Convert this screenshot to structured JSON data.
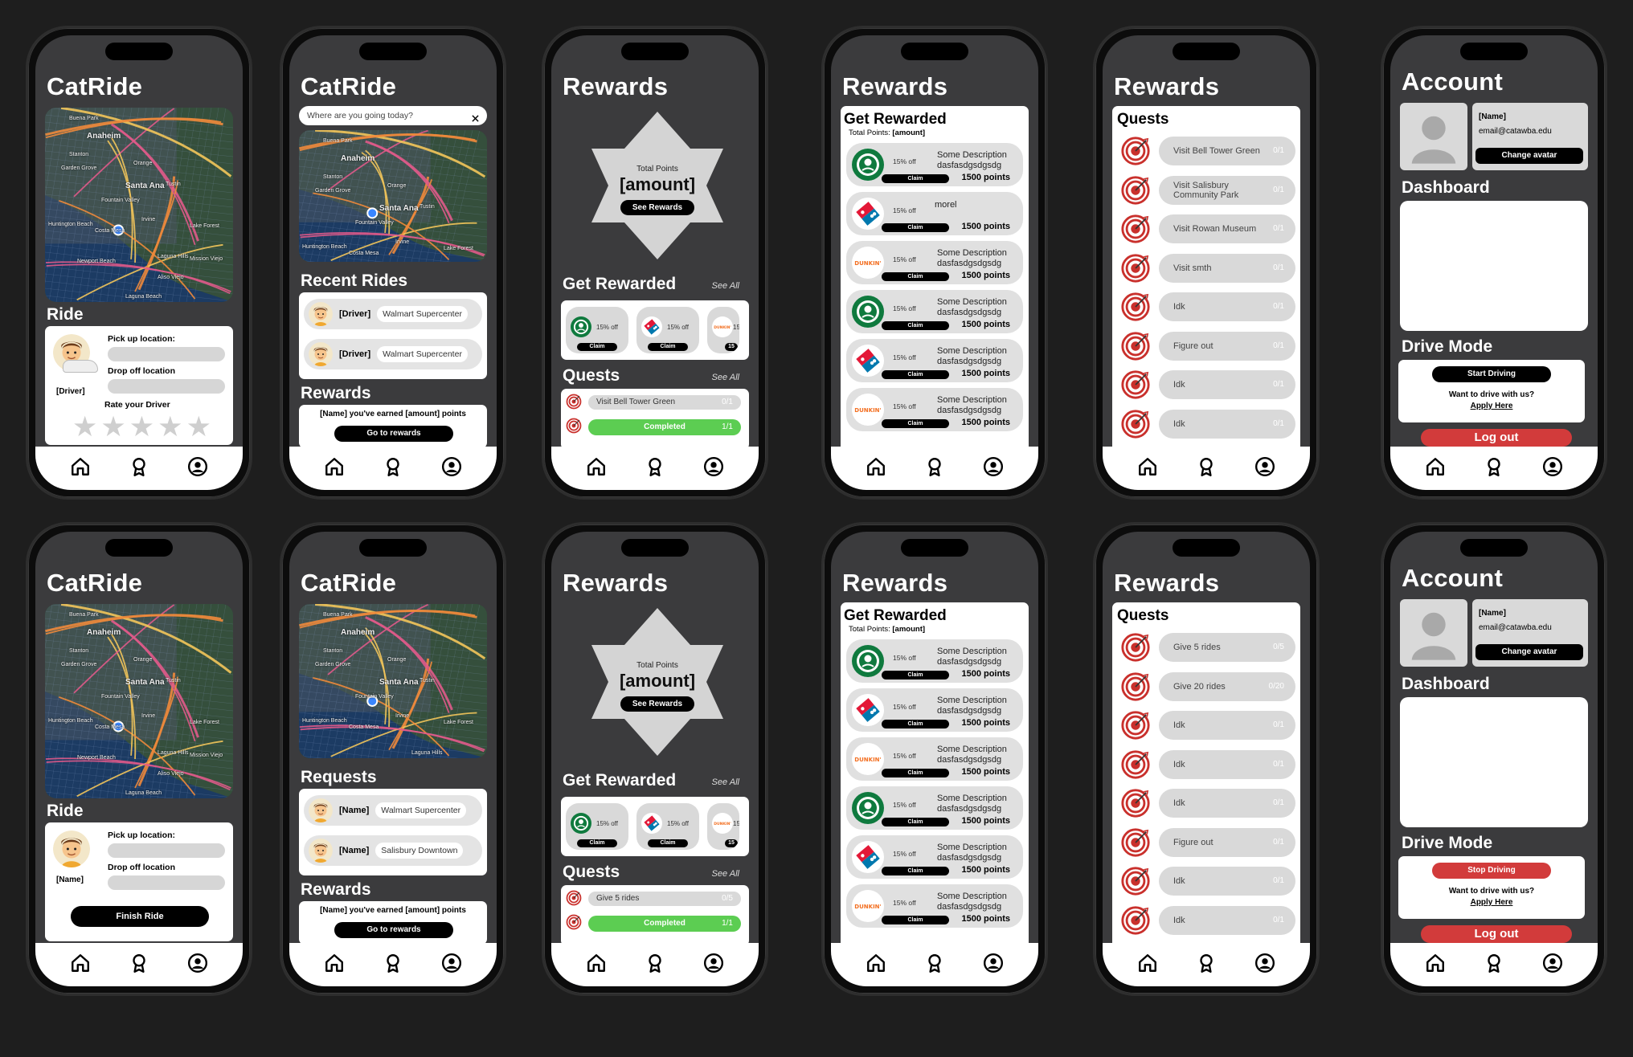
{
  "app": {
    "name": "CatRide"
  },
  "common": {
    "ride_heading": "Ride",
    "pickup_label": "Pick up location:",
    "dropoff_label": "Drop off location",
    "search_placeholder": "Where are you going today?",
    "search_clear": "×",
    "rewards_title": "Rewards",
    "total_points_label": "Total Points",
    "amount": "[amount]",
    "see_rewards": "See Rewards",
    "get_rewarded": "Get Rewarded",
    "see_all": "See All",
    "quests": "Quests",
    "total_points_inline_prefix": "Total Points: ",
    "off": "15% off",
    "off_short": "15",
    "claim": "Claim",
    "earned_msg": "[Name] you've earned [amount] points",
    "go_to_rewards": "Go to rewards",
    "completed": "Completed",
    "one_of_one": "1/1",
    "account_title": "Account",
    "name_tag": "[Name]",
    "email": "email@catawba.edu",
    "change_avatar": "Change avatar",
    "dashboard": "Dashboard",
    "drive_mode": "Drive Mode",
    "want_drive": "Want to drive with us?",
    "apply_here": "Apply Here",
    "log_out": "Log out",
    "star": "★",
    "rate_driver": "Rate your Driver",
    "driver_tag": "[Driver]",
    "finish_ride": "Finish Ride",
    "recent_rides": "Recent Rides",
    "requests": "Requests",
    "start_driving": "Start Driving",
    "stop_driving": "Stop Driving",
    "points_1500": "1500 points"
  },
  "map_labels": [
    "Buena Park",
    "Anaheim",
    "Stanton",
    "Garden Grove",
    "Orange",
    "Santa Ana",
    "Tustin",
    "Fountain Valley",
    "Huntington Beach",
    "Costa Mesa",
    "Irvine",
    "Lake Forest",
    "Laguna Hills",
    "Newport Beach",
    "Aliso Viejo",
    "Laguna Beach",
    "Mission Viejo"
  ],
  "recent_rides": [
    {
      "tag": "[Driver]",
      "dest": "Walmart Supercenter"
    },
    {
      "tag": "[Driver]",
      "dest": "Walmart Supercenter"
    }
  ],
  "requests": [
    {
      "tag": "[Name]",
      "dest": "Walmart Supercenter"
    },
    {
      "tag": "[Name]",
      "dest": "Salisbury Downtown"
    }
  ],
  "rewards_list": [
    {
      "brand": "starbucks",
      "desc": "Some Description dasfasdgsdgsdg"
    },
    {
      "brand": "dominos",
      "desc": "morel"
    },
    {
      "brand": "dunkin",
      "desc": "Some Description dasfasdgsdgsdg"
    },
    {
      "brand": "starbucks",
      "desc": "Some Description dasfasdgsdgsdg"
    },
    {
      "brand": "dominos",
      "desc": "Some Description dasfasdgsdgsdg"
    },
    {
      "brand": "dunkin",
      "desc": "Some Description dasfasdgsdgsdg"
    }
  ],
  "rewards_list_b": [
    {
      "brand": "starbucks",
      "desc": "Some Description dasfasdgsdgsdg"
    },
    {
      "brand": "dominos",
      "desc": "Some Description dasfasdgsdgsdg"
    },
    {
      "brand": "dunkin",
      "desc": "Some Description dasfasdgsdgsdg"
    },
    {
      "brand": "starbucks",
      "desc": "Some Description dasfasdgsdgsdg"
    },
    {
      "brand": "dominos",
      "desc": "Some Description dasfasdgsdgsdg"
    },
    {
      "brand": "dunkin",
      "desc": "Some Description dasfasdgsdgsdg"
    }
  ],
  "quests_a": [
    {
      "name": "Visit Bell Tower Green",
      "count": "0/1"
    },
    {
      "name": "Visit Salisbury Community Park",
      "count": "0/1"
    },
    {
      "name": "Visit Rowan Museum",
      "count": "0/1"
    },
    {
      "name": "Visit smth",
      "count": "0/1"
    },
    {
      "name": "Idk",
      "count": "0/1"
    },
    {
      "name": "Figure out",
      "count": "0/1"
    },
    {
      "name": "Idk",
      "count": "0/1"
    },
    {
      "name": "Idk",
      "count": "0/1"
    }
  ],
  "quests_b": [
    {
      "name": "Give 5 rides",
      "count": "0/5"
    },
    {
      "name": "Give 20 rides",
      "count": "0/20"
    },
    {
      "name": "Idk",
      "count": "0/1"
    },
    {
      "name": "Idk",
      "count": "0/1"
    },
    {
      "name": "Idk",
      "count": "0/1"
    },
    {
      "name": "Figure out",
      "count": "0/1"
    },
    {
      "name": "Idk",
      "count": "0/1"
    },
    {
      "name": "Idk",
      "count": "0/1"
    }
  ],
  "quest_preview_a": {
    "name": "Visit Bell Tower Green",
    "count": "0/1"
  },
  "quest_preview_b": {
    "name": "Give 5 rides",
    "count": "0/5"
  },
  "colors": {
    "bg": "#1e1e1e",
    "screen": "#3b3b3d",
    "green": "#5ccd52",
    "red": "#d23b3b",
    "starbucks": "#0f7a3e",
    "dominos": "#1a4fa0",
    "dunkin": "#f36f21"
  }
}
